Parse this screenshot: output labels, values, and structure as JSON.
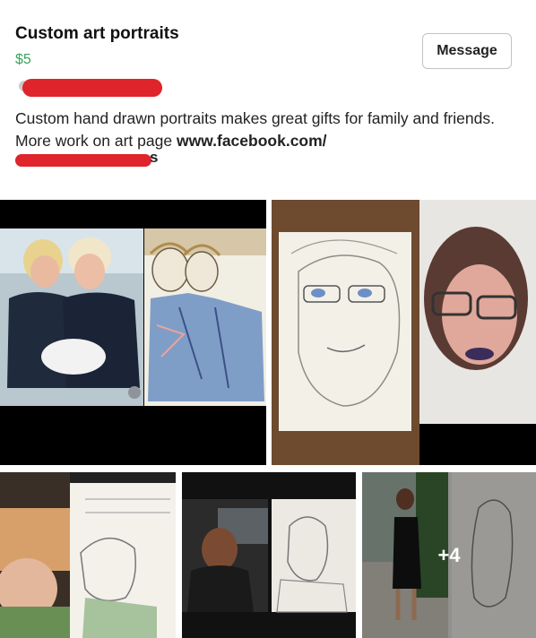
{
  "listing": {
    "title": "Custom art portraits",
    "price": "$5",
    "message_label": "Message",
    "seller_suffix": "s",
    "description_text": "Custom hand drawn portraits makes great gifts for family and friends. More work on art page ",
    "description_link": "www.facebook.com/"
  },
  "gallery": {
    "more_count": "+4"
  },
  "colors": {
    "price": "#3aa35a",
    "redaction": "#e0242b"
  }
}
